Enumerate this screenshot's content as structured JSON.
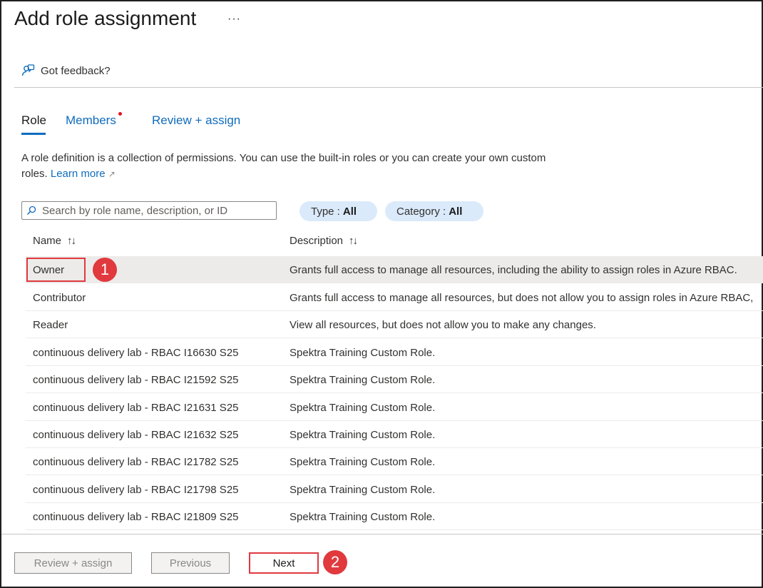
{
  "header": {
    "title": "Add role assignment",
    "more": "···"
  },
  "feedback": {
    "label": "Got feedback?"
  },
  "tabs": [
    {
      "label": "Role",
      "active": true
    },
    {
      "label": "Members",
      "has_dot": true
    },
    {
      "label": "Review + assign"
    }
  ],
  "description": {
    "text": "A role definition is a collection of permissions. You can use the built-in roles or you can create your own custom roles.",
    "link": "Learn more"
  },
  "search": {
    "placeholder": "Search by role name, description, or ID",
    "value": ""
  },
  "filters": {
    "type": {
      "label": "Type :",
      "value": "All"
    },
    "category": {
      "label": "Category :",
      "value": "All"
    }
  },
  "table": {
    "columns": [
      "Name",
      "Description"
    ],
    "sort_glyph": "↑↓",
    "rows": [
      {
        "name": "Owner",
        "description": "Grants full access to manage all resources, including the ability to assign roles in Azure RBAC.",
        "selected": true
      },
      {
        "name": "Contributor",
        "description": "Grants full access to manage all resources, but does not allow you to assign roles in Azure RBAC,"
      },
      {
        "name": "Reader",
        "description": "View all resources, but does not allow you to make any changes."
      },
      {
        "name": "continuous delivery lab - RBAC I16630 S25",
        "description": "Spektra Training Custom Role."
      },
      {
        "name": "continuous delivery lab - RBAC I21592 S25",
        "description": "Spektra Training Custom Role."
      },
      {
        "name": "continuous delivery lab - RBAC I21631 S25",
        "description": "Spektra Training Custom Role."
      },
      {
        "name": "continuous delivery lab - RBAC I21632 S25",
        "description": "Spektra Training Custom Role."
      },
      {
        "name": "continuous delivery lab - RBAC I21782 S25",
        "description": "Spektra Training Custom Role."
      },
      {
        "name": "continuous delivery lab - RBAC I21798 S25",
        "description": "Spektra Training Custom Role."
      },
      {
        "name": "continuous delivery lab - RBAC I21809 S25",
        "description": "Spektra Training Custom Role."
      }
    ]
  },
  "footer": {
    "review_assign": "Review + assign",
    "previous": "Previous",
    "next": "Next"
  },
  "annotations": {
    "step1": "1",
    "step2": "2",
    "color": "#e0393e"
  },
  "colors": {
    "accent": "#0f6cbd",
    "pill_bg": "#dbeafa",
    "selected_row": "#edebe9"
  }
}
